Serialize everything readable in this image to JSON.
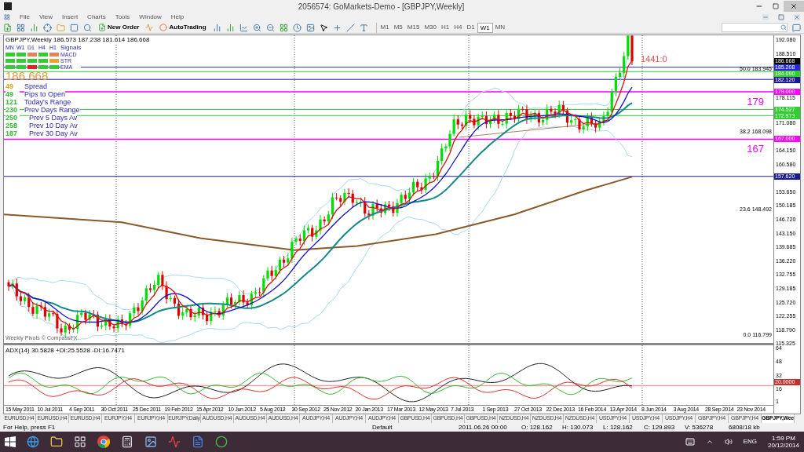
{
  "window": {
    "title": "2056574: GoMarkets-Demo - [GBPJPY,Weekly]"
  },
  "menu": [
    "File",
    "View",
    "Insert",
    "Charts",
    "Tools",
    "Window",
    "Help"
  ],
  "toolbar": {
    "buttons": [
      "New Order",
      "AutoTrading"
    ],
    "timeframes": [
      {
        "label": "M1",
        "selected": false
      },
      {
        "label": "M5",
        "selected": false
      },
      {
        "label": "M15",
        "selected": false
      },
      {
        "label": "M30",
        "selected": false
      },
      {
        "label": "H1",
        "selected": false
      },
      {
        "label": "H4",
        "selected": false
      },
      {
        "label": "D1",
        "selected": false
      },
      {
        "label": "W1",
        "selected": true
      },
      {
        "label": "MN",
        "selected": false
      }
    ]
  },
  "chart": {
    "header": "GBPJPY,Weekly  186.573 187.238 181.614 186.668",
    "signals": {
      "columns": [
        "MN",
        "W1",
        "D1",
        "H4",
        "H1"
      ],
      "title": "Signals",
      "rows": [
        {
          "label": "MACD",
          "cells": [
            {
              "color": "#33cc33"
            },
            {
              "color": "#33cc33"
            },
            {
              "color": "#e8805a"
            },
            {
              "color": "#33cc33"
            },
            {
              "color": "#e8805a"
            }
          ]
        },
        {
          "label": "STR",
          "cells": [
            {
              "color": "#33cc33"
            },
            {
              "color": "#33cc33"
            },
            {
              "color": "#33cc33"
            },
            {
              "color": "#33cc33"
            },
            {
              "color": "#f0a030"
            }
          ]
        },
        {
          "label": "EMA",
          "cells": [
            {
              "color": "#33cc33"
            },
            {
              "color": "#33cc33"
            },
            {
              "color": "#dd2222"
            },
            {
              "color": "#33cc33"
            },
            {
              "color": "#33cc33"
            }
          ]
        }
      ]
    },
    "price": "186.668",
    "stats": [
      {
        "value": "49",
        "label": "Spread",
        "color": "#e0a020"
      },
      {
        "value": "49",
        "label": "Pips to Open",
        "color": "#33bb33"
      },
      {
        "value": "121",
        "label": "Today's Range",
        "color": "#33bb33"
      },
      {
        "value": "230",
        "label": "Prev Days Range",
        "color": "#33bb33"
      },
      {
        "value": "250",
        "label": "Prev 5 Days Av",
        "color": "#33bb33"
      },
      {
        "value": "258",
        "label": "Prev 10 Day Av",
        "color": "#33bb33"
      },
      {
        "value": "187",
        "label": "Prev 30 Day Av",
        "color": "#33bb33"
      }
    ],
    "countdown": "1441:0",
    "fib_labels": [
      {
        "level": "50.0",
        "price": "183.945"
      },
      {
        "level": "38.2",
        "price": "168.098"
      },
      {
        "level": "23.6",
        "price": "148.492"
      },
      {
        "level": "0.0",
        "price": "116.799"
      }
    ],
    "footer_label": "Weekly Pivots © CompassFX",
    "price_axis": [
      "192.080",
      "188.510",
      "178.115",
      "171.080",
      "164.150",
      "160.580",
      "153.650",
      "150.185",
      "146.720",
      "143.150",
      "139.685",
      "136.220",
      "132.755",
      "129.185",
      "125.720",
      "122.255",
      "118.790",
      "115.325"
    ],
    "price_markers": [
      {
        "text": "186.668",
        "color": "#000000",
        "kind": "bid"
      },
      {
        "text": "185.208",
        "color": "#2a2acc",
        "kind": "level"
      },
      {
        "text": "184.090",
        "color": "#33cc33",
        "kind": "level"
      },
      {
        "text": "182.120",
        "color": "#1a1a8c",
        "kind": "level"
      },
      {
        "text": "179.000",
        "color": "#ff00ff",
        "kind": "level",
        "note": "179"
      },
      {
        "text": "174.527",
        "color": "#33cc33",
        "kind": "level"
      },
      {
        "text": "172.973",
        "color": "#33cc33",
        "kind": "level"
      },
      {
        "text": "167.000",
        "color": "#ff00ff",
        "kind": "level",
        "note": "167"
      },
      {
        "text": "157.620",
        "color": "#1a1a8c",
        "kind": "level"
      }
    ],
    "date_axis": [
      "15 May 2011",
      "10 Jul 2011",
      "4 Sep 2011",
      "30 Oct 2011",
      "25 Dec 2011",
      "19 Feb 2012",
      "15 Apr 2012",
      "10 Jun 2012",
      "5 Aug 2012",
      "30 Sep 2012",
      "25 Nov 2012",
      "20 Jan 2013",
      "17 Mar 2013",
      "12 May 2013",
      "7 Jul 2013",
      "1 Sep 2013",
      "27 Oct 2013",
      "22 Dec 2013",
      "16 Feb 2014",
      "13 Apr 2014",
      "8 Jun 2014",
      "3 Aug 2014",
      "28 Sep 2014",
      "23 Nov 2014"
    ],
    "indicator": {
      "label": "ADX(14) 30.5828 +DI:25.5528 -DI:16.7471",
      "axis": [
        "64",
        "48",
        "32",
        "16",
        "1"
      ],
      "marker": "20.0000"
    }
  },
  "chart_tabs": [
    {
      "label": "EURUSD,H4",
      "selected": false
    },
    {
      "label": "EURUSD,H4",
      "selected": false
    },
    {
      "label": "EURUSD,H4",
      "selected": false
    },
    {
      "label": "EURJPY,H4",
      "selected": false
    },
    {
      "label": "EURJPY,H4",
      "selected": false
    },
    {
      "label": "EURJPY,Daily",
      "selected": false
    },
    {
      "label": "AUDUSD,H4",
      "selected": false
    },
    {
      "label": "AUDUSD,H4",
      "selected": false
    },
    {
      "label": "AUDUSD,H4",
      "selected": false
    },
    {
      "label": "AUDJPY,H4",
      "selected": false
    },
    {
      "label": "AUDJPY,H4",
      "selected": false
    },
    {
      "label": "AUDJPY,H4",
      "selected": false
    },
    {
      "label": "GBPUSD,H4",
      "selected": false
    },
    {
      "label": "GBPUSD,H4",
      "selected": false
    },
    {
      "label": "GBPUSD,H4",
      "selected": false
    },
    {
      "label": "NZDUSD,H4",
      "selected": false
    },
    {
      "label": "NZDUSD,H4",
      "selected": false
    },
    {
      "label": "NZDUSD,H4",
      "selected": false
    },
    {
      "label": "USDJPY,H4",
      "selected": false
    },
    {
      "label": "USDJPY,H4",
      "selected": false
    },
    {
      "label": "USDJPY,H4",
      "selected": false
    },
    {
      "label": "GBPJPY,H4",
      "selected": false
    },
    {
      "label": "GBPJPY,H4",
      "selected": false
    },
    {
      "label": "GBPJPY,Wee",
      "selected": true
    }
  ],
  "status_bar": {
    "help": "For Help, press F1",
    "profile": "Default",
    "time": "2011.06.26 00:00",
    "open": "O: 128.162",
    "high": "H: 130.073",
    "low": "L: 128.162",
    "close": "C: 129.893",
    "volume": "V: 536278",
    "traffic": "6808/18 kb"
  },
  "taskbar": {
    "language": "ENG",
    "time": "1:59 PM",
    "date": "20/12/2014"
  }
}
